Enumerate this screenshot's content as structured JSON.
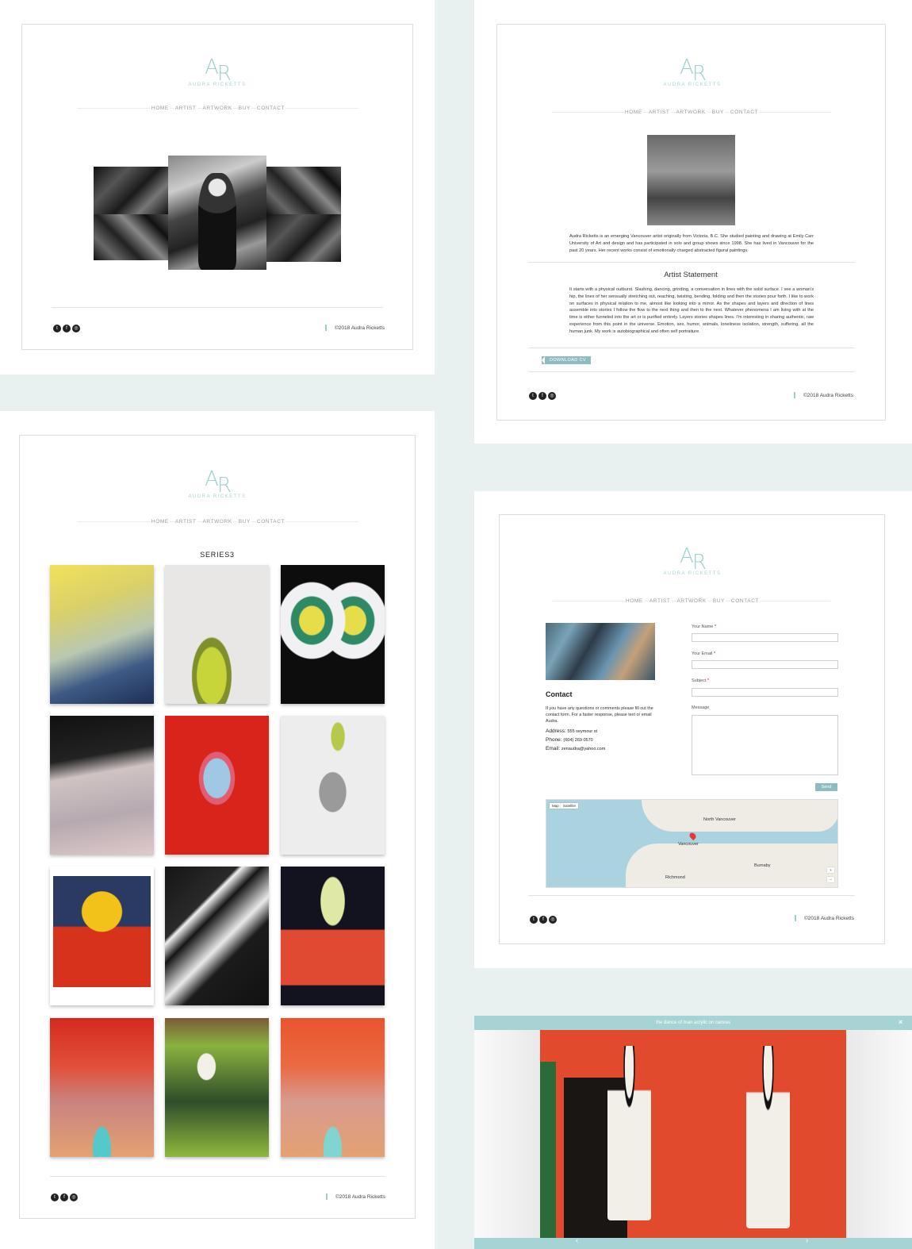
{
  "brand": {
    "monogram_a": "A",
    "monogram_r": "R",
    "name": "AUDRA RICKETTS"
  },
  "nav": [
    "HOME",
    "ARTIST",
    "ARTWORK",
    "BUY",
    "CONTACT"
  ],
  "footer": {
    "copyright": "©2018 Audra Ricketts",
    "social_icons": [
      "twitter-icon",
      "facebook-icon",
      "instagram-icon"
    ]
  },
  "artist": {
    "bio": "Audra Ricketts is an emerging Vancouver artist originally from Victoria, B.C. She studied painting and drawing at Emily Carr University of Art and design and has participated in solo and group shows since 1998. She has lived in Vancouver for the past 20 years. Her recent works consist of emotionally charged abstracted figural paintings.",
    "statement_title": "Artist Statement",
    "statement": "It starts with a physical outburst. Slashing, dancing, grinding, a conversation in lines with the solid surface. I see a woman's hip, the lines of her sensually stretching out, reaching, twisting, bending, folding and then the stories pour forth. I like to work on surfaces in physical relation to me, almost like looking into a mirror. As the shapes and layers and direction of lines assemble into stories I follow the flow to the next thing and then to the next. Whatever phenomena I am living with at the time is either funneled into the art or is purified entirely. Layers stories shapes lines. I'm interesting in sharing authentic, raw experience from this point in the universe. Emotion, sex, humor, animals, loneliness isolation, strength, suffering, all the human junk. My work is autobiographical and often self portraiture.",
    "cv_button": "DOWNLOAD CV"
  },
  "artwork": {
    "series_title": "SERIES3"
  },
  "contact": {
    "title": "Contact",
    "intro": "If you have any questions or comments please fill out the contact form. For a faster response, please text or email Audra.",
    "address_label": "Address:",
    "address": "555 seymour st",
    "phone_label": "Phone:",
    "phone": "(604) 269 0570",
    "email_label": "Email:",
    "email": "zenaudra@yahoo.com",
    "form": {
      "name_label": "Your Name",
      "email_label": "Your Email",
      "subject_label": "Subject",
      "message_label": "Message",
      "required_mark": "*",
      "send_label": "Send"
    },
    "map": {
      "map_tab": "Map",
      "satellite_tab": "Satellite",
      "city": "Vancouver",
      "labels": [
        "North Vancouver",
        "Burnaby",
        "Richmond"
      ]
    }
  },
  "lightbox": {
    "caption": "the dance of man acrylic on canvas",
    "close": "×",
    "prev": "‹",
    "next": "›"
  },
  "colors": {
    "accent": "#9dcfd0",
    "band": "#e8f1ef",
    "button": "#8fbcc0"
  }
}
